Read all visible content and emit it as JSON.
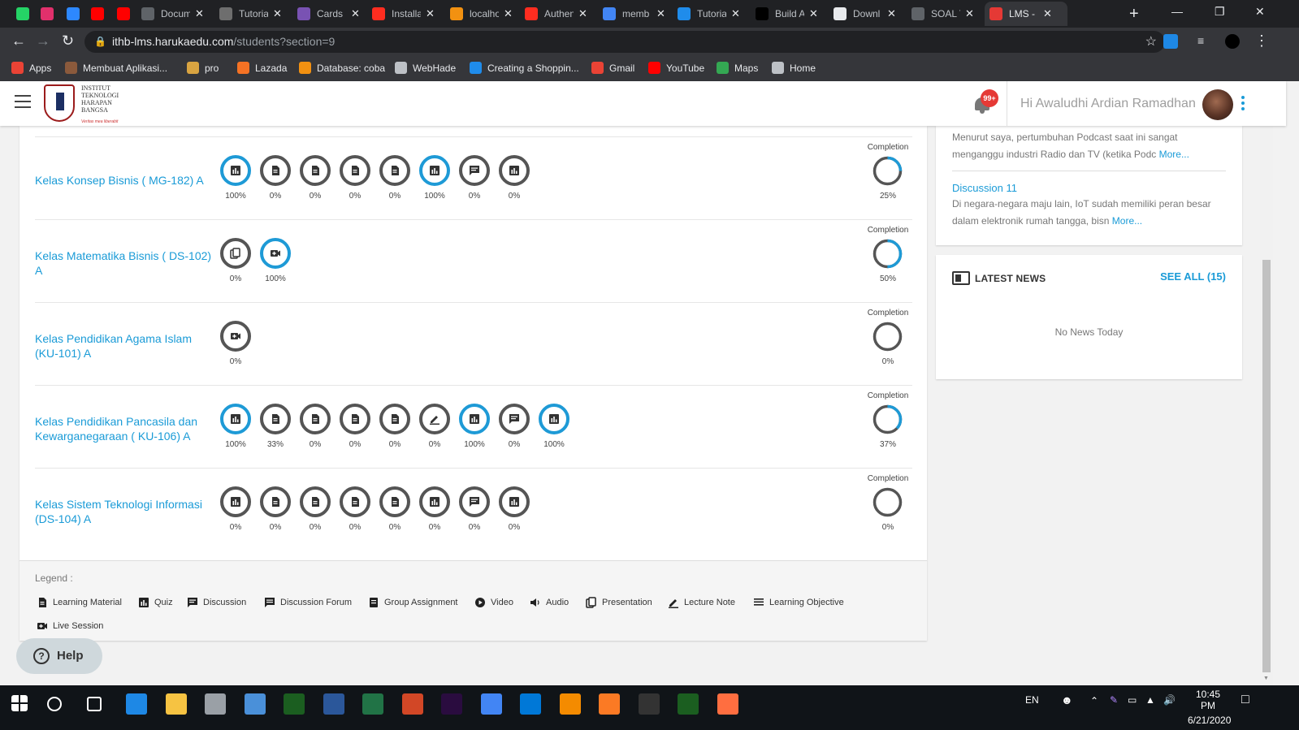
{
  "browser": {
    "tabs": [
      {
        "label": "",
        "color": "#25d366",
        "icon": "whatsapp-icon"
      },
      {
        "label": "",
        "color": "#e1306c",
        "icon": "instagram-icon"
      },
      {
        "label": "",
        "color": "#2d88ff",
        "icon": "p-icon"
      },
      {
        "label": "",
        "color": "#ff0000",
        "icon": "youtube-icon"
      },
      {
        "label": "",
        "color": "#ff0000",
        "icon": "youtube-icon"
      },
      {
        "label": "Docum",
        "color": "#5f6368",
        "icon": "globe-icon"
      },
      {
        "label": "Tutoria",
        "color": "#6e6e6e",
        "icon": "github-icon"
      },
      {
        "label": "Cards",
        "color": "#7952b3",
        "icon": "bootstrap-icon"
      },
      {
        "label": "Installa",
        "color": "#ff2d20",
        "icon": "laravel-icon"
      },
      {
        "label": "localho",
        "color": "#f29111",
        "icon": "phpmyadmin-icon"
      },
      {
        "label": "Authen",
        "color": "#ff2d20",
        "icon": "laravel-icon"
      },
      {
        "label": "memb",
        "color": "#4285f4",
        "icon": "google-icon"
      },
      {
        "label": "Tutoria",
        "color": "#1f8ceb",
        "icon": "diamond-icon"
      },
      {
        "label": "Build A",
        "color": "#000000",
        "icon": "medium-icon"
      },
      {
        "label": "Downl",
        "color": "#e8eaed",
        "icon": "download-icon"
      },
      {
        "label": "SOAL T",
        "color": "#5f6368",
        "icon": "globe-icon"
      },
      {
        "label": "LMS -",
        "color": "#e53935",
        "icon": "lms-icon"
      }
    ],
    "new_tab": "+",
    "url_host": "ithb-lms.harukaedu.com",
    "url_path": "/students?section=9",
    "bookmarks": [
      {
        "label": "Apps",
        "color": "#ea4335"
      },
      {
        "label": "Membuat Aplikasi...",
        "color": "#8b5a3c"
      },
      {
        "label": "pro",
        "color": "#d9a441"
      },
      {
        "label": "Lazada",
        "color": "#f57224"
      },
      {
        "label": "Database: coba",
        "color": "#f29111"
      },
      {
        "label": "WebHade",
        "color": "#bdc1c6"
      },
      {
        "label": "Creating a Shoppin...",
        "color": "#1f8ceb"
      },
      {
        "label": "Gmail",
        "color": "#ea4335"
      },
      {
        "label": "YouTube",
        "color": "#ff0000"
      },
      {
        "label": "Maps",
        "color": "#34a853"
      },
      {
        "label": "Home",
        "color": "#bdc1c6"
      }
    ]
  },
  "header": {
    "logo_lines": [
      "Institut",
      "Teknologi",
      "Harapan",
      "Bangsa"
    ],
    "logo_tag": "Veritas mea liberabit",
    "notif_badge": "99+",
    "greeting": "Hi Awaludhi Ardian Ramadhan"
  },
  "courses": [
    {
      "name": "Kelas Konsep Bisnis ( MG-182) A",
      "activities": [
        {
          "type": "quiz",
          "pct": "100%",
          "done": true
        },
        {
          "type": "material",
          "pct": "0%",
          "done": false
        },
        {
          "type": "material",
          "pct": "0%",
          "done": false
        },
        {
          "type": "material",
          "pct": "0%",
          "done": false
        },
        {
          "type": "material",
          "pct": "0%",
          "done": false
        },
        {
          "type": "quiz",
          "pct": "100%",
          "done": true
        },
        {
          "type": "discussion",
          "pct": "0%",
          "done": false
        },
        {
          "type": "quiz",
          "pct": "0%",
          "done": false
        }
      ],
      "completion_label": "Completion",
      "completion": "25%",
      "completion_value": 0.25
    },
    {
      "name": "Kelas Matematika Bisnis ( DS-102) A",
      "activities": [
        {
          "type": "presentation",
          "pct": "0%",
          "done": false
        },
        {
          "type": "live",
          "pct": "100%",
          "done": true
        }
      ],
      "completion_label": "Completion",
      "completion": "50%",
      "completion_value": 0.5
    },
    {
      "name": "Kelas Pendidikan Agama Islam (KU-101) A",
      "activities": [
        {
          "type": "live",
          "pct": "0%",
          "done": false
        }
      ],
      "completion_label": "Completion",
      "completion": "0%",
      "completion_value": 0
    },
    {
      "name": "Kelas Pendidikan Pancasila dan Kewarganegaraan ( KU-106) A",
      "activities": [
        {
          "type": "quiz",
          "pct": "100%",
          "done": true
        },
        {
          "type": "material",
          "pct": "33%",
          "done": false
        },
        {
          "type": "material",
          "pct": "0%",
          "done": false
        },
        {
          "type": "material",
          "pct": "0%",
          "done": false
        },
        {
          "type": "material",
          "pct": "0%",
          "done": false
        },
        {
          "type": "lecture",
          "pct": "0%",
          "done": false
        },
        {
          "type": "quiz",
          "pct": "100%",
          "done": true
        },
        {
          "type": "discussion",
          "pct": "0%",
          "done": false
        },
        {
          "type": "quiz",
          "pct": "100%",
          "done": true
        }
      ],
      "completion_label": "Completion",
      "completion": "37%",
      "completion_value": 0.37
    },
    {
      "name": "Kelas Sistem Teknologi Informasi (DS-104) A",
      "activities": [
        {
          "type": "quiz",
          "pct": "0%",
          "done": false
        },
        {
          "type": "material",
          "pct": "0%",
          "done": false
        },
        {
          "type": "material",
          "pct": "0%",
          "done": false
        },
        {
          "type": "material",
          "pct": "0%",
          "done": false
        },
        {
          "type": "material",
          "pct": "0%",
          "done": false
        },
        {
          "type": "quiz",
          "pct": "0%",
          "done": false
        },
        {
          "type": "discussion",
          "pct": "0%",
          "done": false
        },
        {
          "type": "quiz",
          "pct": "0%",
          "done": false
        }
      ],
      "completion_label": "Completion",
      "completion": "0%",
      "completion_value": 0
    }
  ],
  "legend": {
    "title": "Legend :",
    "items": [
      {
        "label": "Learning Material",
        "icon": "material"
      },
      {
        "label": "Quiz",
        "icon": "quiz"
      },
      {
        "label": "Discussion",
        "icon": "discussion"
      },
      {
        "label": "Discussion Forum",
        "icon": "forum"
      },
      {
        "label": "Group Assignment",
        "icon": "group"
      },
      {
        "label": "Video",
        "icon": "video"
      },
      {
        "label": "Audio",
        "icon": "audio"
      },
      {
        "label": "Presentation",
        "icon": "presentation"
      },
      {
        "label": "Lecture Note",
        "icon": "lecture"
      },
      {
        "label": "Learning Objective",
        "icon": "objective"
      },
      {
        "label": "Live Session",
        "icon": "live"
      }
    ]
  },
  "help": {
    "label": "Help",
    "icon_glyph": "?"
  },
  "discussions": {
    "first_text": "Menurut saya, pertumbuhan Podcast saat ini sangat menganggu industri Radio dan TV (ketika Podc",
    "first_more": "More...",
    "second_title": "Discussion 11",
    "second_text": "Di negara-negara maju lain, IoT sudah memiliki peran besar dalam elektronik rumah tangga, bisn",
    "second_more": "More..."
  },
  "news": {
    "title": "LATEST NEWS",
    "see_all": "SEE ALL (15)",
    "empty": "No News Today"
  },
  "taskbar": {
    "lang": "EN",
    "time": "10:45 PM",
    "date": "6/21/2020",
    "apps": [
      {
        "name": "search",
        "color": "#ffffff"
      },
      {
        "name": "task-view",
        "color": "#ffffff"
      },
      {
        "name": "edge",
        "color": "#1e88e5"
      },
      {
        "name": "explorer",
        "color": "#f6c342"
      },
      {
        "name": "camera",
        "color": "#9aa0a6"
      },
      {
        "name": "app-s",
        "color": "#4a90d9"
      },
      {
        "name": "hs",
        "color": "#1b5e20"
      },
      {
        "name": "word",
        "color": "#2b579a"
      },
      {
        "name": "excel",
        "color": "#217346"
      },
      {
        "name": "powerpoint",
        "color": "#d24726"
      },
      {
        "name": "premiere",
        "color": "#2a0c3f"
      },
      {
        "name": "chrome",
        "color": "#4285f4"
      },
      {
        "name": "vscode",
        "color": "#0078d7"
      },
      {
        "name": "vlc",
        "color": "#f48b00"
      },
      {
        "name": "xampp",
        "color": "#fb7a24"
      },
      {
        "name": "terminal",
        "color": "#333333"
      },
      {
        "name": "hs2",
        "color": "#1b5e20"
      },
      {
        "name": "sublime",
        "color": "#ff6e40"
      }
    ]
  },
  "colors": {
    "accent": "#1a9bd7",
    "ring_done": "#1e9ad6",
    "ring_todo": "#555555"
  }
}
